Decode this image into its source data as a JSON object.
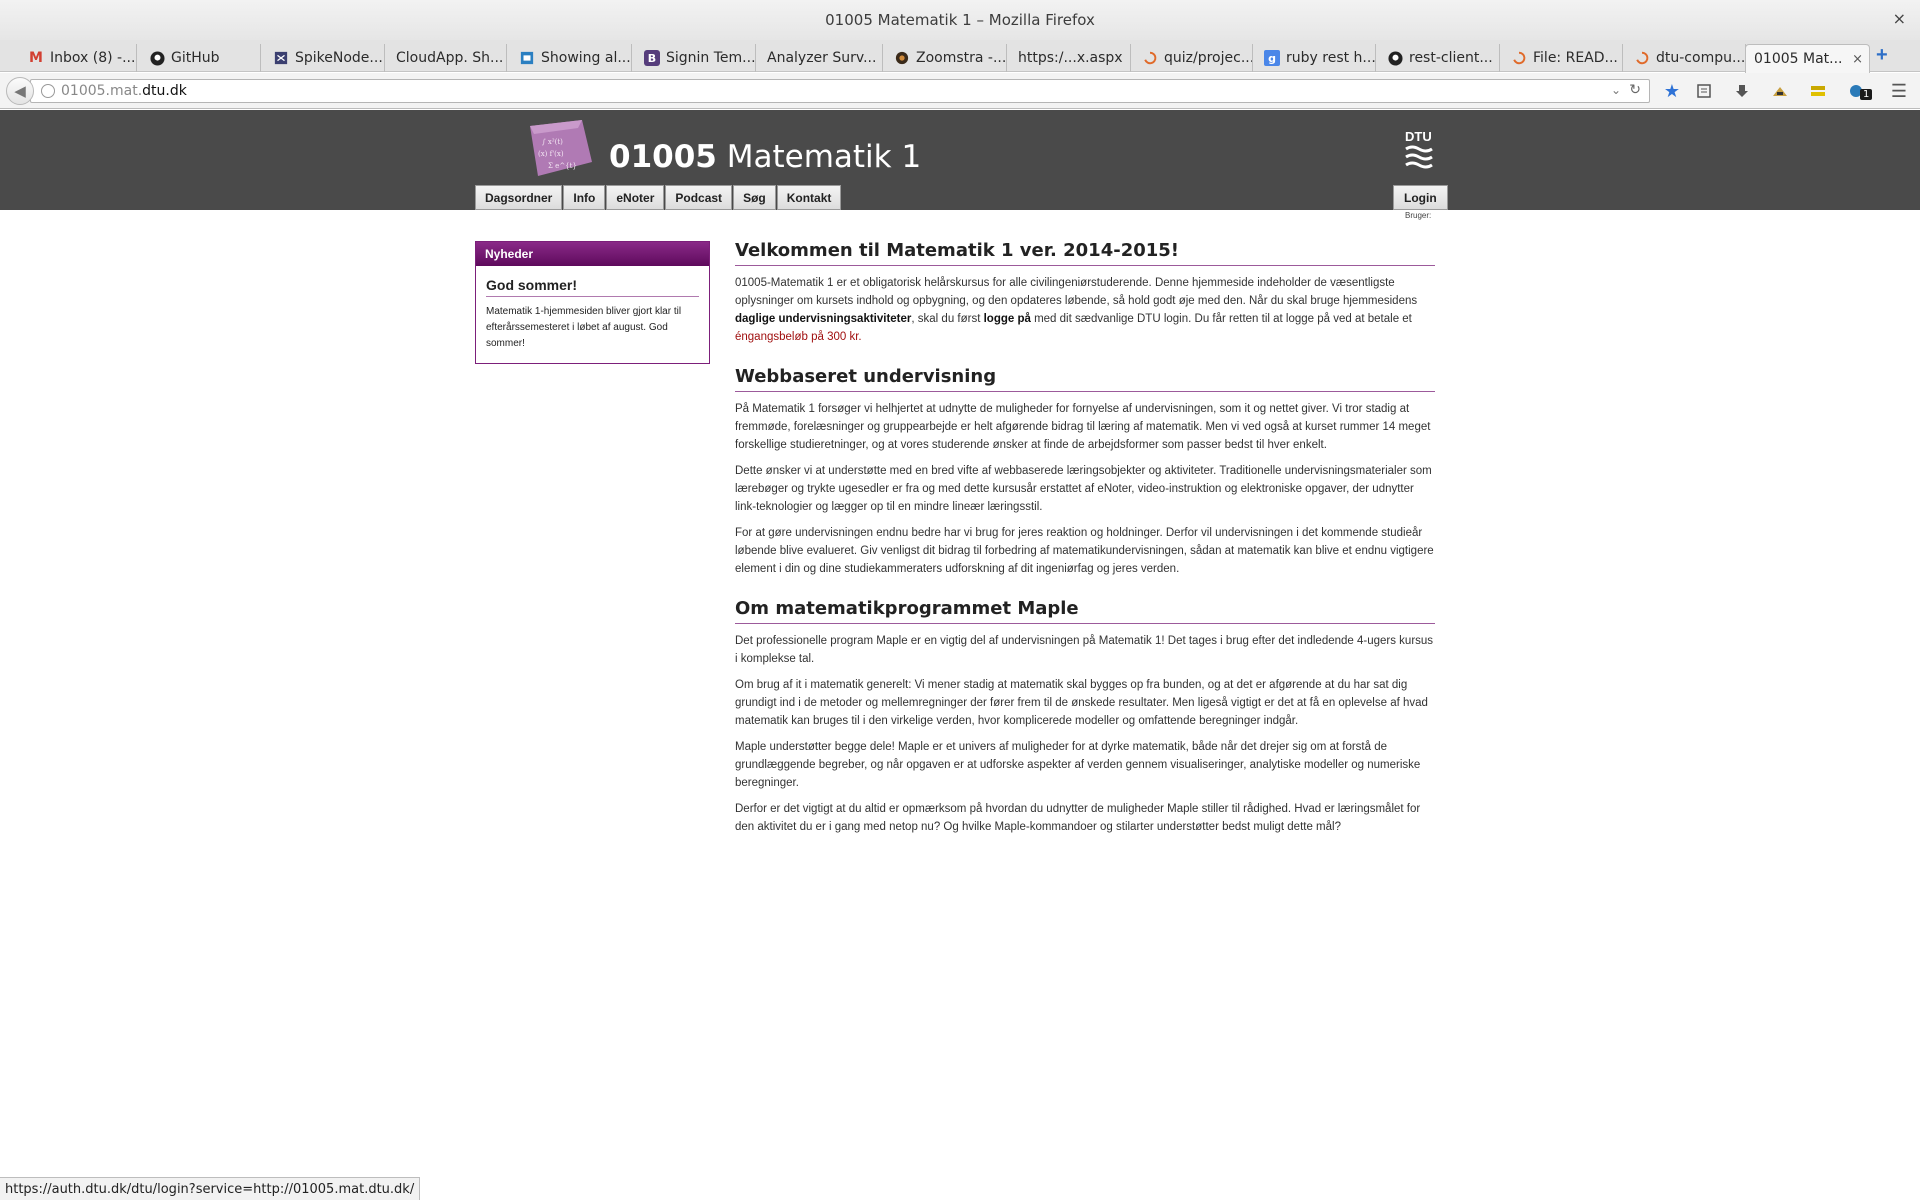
{
  "window": {
    "title": "01005 Matematik 1 – Mozilla Firefox",
    "close_glyph": "×"
  },
  "tabs": [
    {
      "label": "Inbox (8) -...",
      "icon": "gmail-icon"
    },
    {
      "label": "GitHub",
      "icon": "github-icon"
    },
    {
      "label": "SpikeNode...",
      "icon": "spike-icon"
    },
    {
      "label": "CloudApp. Sh...",
      "icon": ""
    },
    {
      "label": "Showing al...",
      "icon": "dashboard-icon"
    },
    {
      "label": "Signin Tem...",
      "icon": "bootstrap-icon"
    },
    {
      "label": "Analyzer Surv...",
      "icon": ""
    },
    {
      "label": "Zoomstra -...",
      "icon": "zoomstra-icon"
    },
    {
      "label": "https:/...x.aspx",
      "icon": ""
    },
    {
      "label": "quiz/projec...",
      "icon": "loading-icon"
    },
    {
      "label": "ruby rest h...",
      "icon": "google-icon"
    },
    {
      "label": "rest-client...",
      "icon": "github-icon"
    },
    {
      "label": "File: READ...",
      "icon": "loading-icon"
    },
    {
      "label": "dtu-compu...",
      "icon": "loading-icon"
    },
    {
      "label": "01005 Mat...",
      "icon": "",
      "active": true
    }
  ],
  "new_tab_glyph": "+",
  "navbar": {
    "url_sub": "01005.mat.",
    "url_domain": "dtu.dk"
  },
  "site": {
    "code": "01005",
    "name": "Matematik 1",
    "dtu_logo_text": "DTU",
    "menu": [
      "Dagsordner",
      "Info",
      "eNoter",
      "Podcast",
      "Søg",
      "Kontakt"
    ],
    "login_label": "Login",
    "user_label": "Bruger:"
  },
  "news": {
    "header": "Nyheder",
    "title": "God sommer!",
    "text": "Matematik 1-hjemmesiden bliver gjort klar til efterårssemesteret i løbet af august. God sommer!"
  },
  "sections": {
    "welcome": {
      "heading": "Velkommen til Matematik 1 ver. 2014-2015!",
      "p1_a": "01005-Matematik 1 er et obligatorisk helårskursus for alle civilingeniørstuderende.  Denne hjemmeside indeholder de væsentligste oplysninger om kursets indhold og opbygning, og den opdateres løbende, så hold godt øje med den. Når du skal bruge hjemmesidens ",
      "p1_bold1": "daglige undervisningsaktiviteter",
      "p1_b": ", skal du først ",
      "p1_bold2": "logge på",
      "p1_c": " med dit sædvanlige DTU login. Du får retten til at logge på ved at betale et ",
      "p1_red": "éngangsbeløb på 300 kr."
    },
    "web": {
      "heading": "Webbaseret undervisning",
      "p1": "På Matematik 1 forsøger vi helhjertet at udnytte de muligheder for fornyelse af undervisningen, som it og nettet giver. Vi tror stadig at fremmøde, forelæsninger og gruppearbejde er helt afgørende bidrag til læring af matematik. Men vi ved også at kurset rummer 14 meget forskellige studieretninger, og at vores studerende ønsker at finde de arbejdsformer som passer bedst til hver enkelt.",
      "p2": "Dette ønsker vi at understøtte med en bred vifte af webbaserede læringsobjekter og aktiviteter. Traditionelle undervisningsmaterialer som lærebøger og trykte ugesedler er fra og med dette kursusår erstattet af eNoter, video-instruktion og elektroniske opgaver, der udnytter link-teknologier og lægger op til en mindre lineær læringsstil.",
      "p3": "For at gøre undervisningen endnu bedre har vi brug for jeres reaktion og holdninger. Derfor vil undervisningen i det kommende studieår løbende blive evalueret. Giv venligst dit bidrag til forbedring af matematikundervisningen, sådan at matematik kan blive et endnu vigtigere element i din og dine studiekammeraters udforskning af dit ingeniørfag og jeres verden."
    },
    "maple": {
      "heading": "Om matematikprogrammet Maple",
      "p1": "Det professionelle program Maple er en vigtig del af undervisningen på Matematik 1! Det tages i brug efter det indledende 4-ugers kursus i komplekse tal.",
      "p2": "Om brug af it i matematik generelt: Vi mener stadig at matematik skal bygges op fra bunden, og at det er afgørende at du har sat dig grundigt ind i de metoder og mellemregninger der fører frem til de ønskede resultater. Men ligeså vigtigt er det at få en oplevelse af hvad matematik kan bruges til i den virkelige verden, hvor komplicerede modeller og omfattende beregninger indgår.",
      "p3": "Maple understøtter begge dele! Maple er et univers af muligheder for at dyrke matematik, både når det drejer sig om at forstå de grundlæggende begreber, og når opgaven er at udforske aspekter af verden gennem visualiseringer, analytiske modeller og numeriske beregninger.",
      "p4": "Derfor er det vigtigt at du altid er opmærksom på hvordan du udnytter de muligheder Maple stiller til rådighed. Hvad er læringsmålet for den aktivitet du er i gang med netop nu? Og hvilke Maple-kommandoer og stilarter understøtter bedst muligt dette mål?"
    }
  },
  "status_url": "https://auth.dtu.dk/dtu/login?service=http://01005.mat.dtu.dk/",
  "colors": {
    "header_bg": "#4a4a4a",
    "accent_purple": "#7c1f7a",
    "link_red": "#a01010"
  }
}
